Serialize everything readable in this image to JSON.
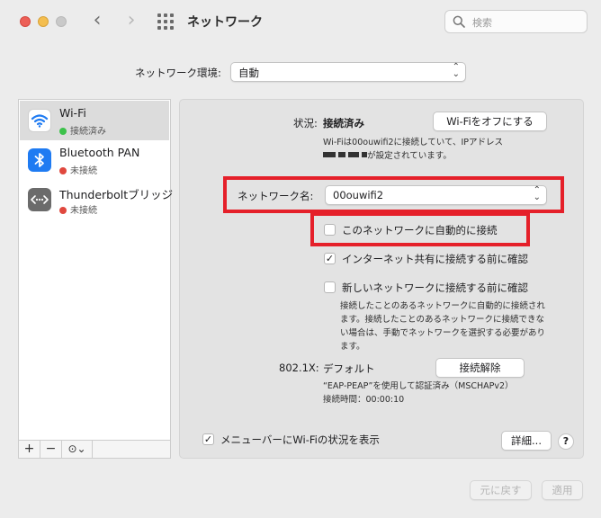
{
  "window": {
    "title": "ネットワーク",
    "search_placeholder": "検索",
    "back_icon": "‹",
    "forward_icon": "›"
  },
  "location": {
    "label": "ネットワーク環境:",
    "value": "自動"
  },
  "sidebar": {
    "services": [
      {
        "name": "Wi-Fi",
        "status": "接続済み",
        "status_color": "#3cc24a",
        "icon": "wifi-icon",
        "selected": true
      },
      {
        "name": "Bluetooth PAN",
        "status": "未接続",
        "status_color": "#e0483e",
        "icon": "bluetooth-icon",
        "selected": false
      },
      {
        "name": "Thunderboltブリッジ",
        "status": "未接続",
        "status_color": "#e0483e",
        "icon": "thunderbolt-bridge-icon",
        "selected": false
      }
    ],
    "tools": {
      "add": "+",
      "remove": "−",
      "action": "⊙⌄"
    }
  },
  "detail": {
    "status_label": "状況:",
    "status_value": "接続済み",
    "wifi_off_button": "Wi-Fiをオフにする",
    "status_description_1": "Wi-Fiは00ouwifi2に接続していて、IPアドレス",
    "status_description_2": "が設定されています。",
    "network_name_label": "ネットワーク名:",
    "network_name_value": "00ouwifi2",
    "auto_join_label": "このネットワークに自動的に接続",
    "auto_join_checked": false,
    "ask_hotspot_label": "インターネット共有に接続する前に確認",
    "ask_hotspot_checked": true,
    "ask_new_label": "新しいネットワークに接続する前に確認",
    "ask_new_checked": false,
    "ask_new_description": [
      "接続したことのあるネットワークに自動的に接続され",
      "ます。接続したことのあるネットワークに接続できな",
      "い場合は、手動でネットワークを選択する必要があり",
      "ます。"
    ],
    "dot1x_label": "802.1X:",
    "dot1x_value": "デフォルト",
    "disconnect_button": "接続解除",
    "auth_description": "“EAP-PEAP”を使用して認証済み（MSCHAPv2）",
    "connect_time": "接続時間：00:00:10",
    "menubar_label": "メニューバーにWi-Fiの状況を表示",
    "menubar_checked": true,
    "advanced_button": "詳細...",
    "help_button": "?"
  },
  "footer": {
    "revert_button": "元に戻す",
    "apply_button": "適用"
  },
  "colors": {
    "highlight_red": "#e5202a",
    "connected_green": "#3cc24a",
    "disconnected_red": "#e0483e"
  }
}
